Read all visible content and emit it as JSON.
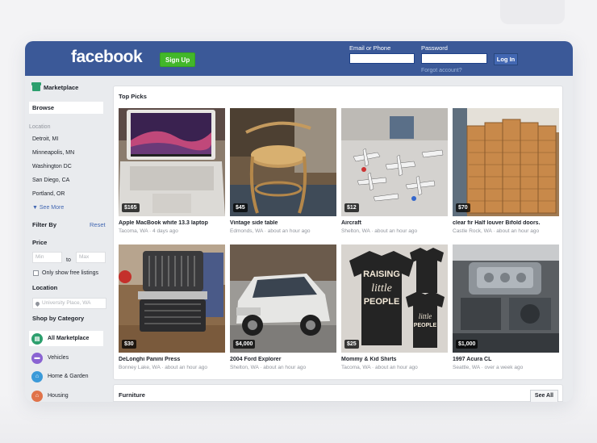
{
  "header": {
    "logo": "facebook",
    "signup_label": "Sign Up",
    "email_label": "Email or Phone",
    "password_label": "Password",
    "login_label": "Log In",
    "forgot_label": "Forgot account?"
  },
  "sidebar": {
    "title": "Marketplace",
    "browse": "Browse",
    "location_label": "Location",
    "locations": [
      "Detroit, MI",
      "Minneapolis, MN",
      "Washington DC",
      "San Diego, CA",
      "Portland, OR"
    ],
    "see_more": "See More",
    "filter_by": "Filter By",
    "reset": "Reset",
    "price_label": "Price",
    "min_placeholder": "Min",
    "to_label": "to",
    "max_placeholder": "Max",
    "free_listings": "Only show free listings",
    "location_head": "Location",
    "location_placeholder": "University Place, WA",
    "shop_by_category": "Shop by Category",
    "categories": [
      {
        "label": "All Marketplace",
        "icon": "storefront-icon",
        "color": "#2d9f6e"
      },
      {
        "label": "Vehicles",
        "icon": "car-icon",
        "color": "#8a63d2"
      },
      {
        "label": "Home & Garden",
        "icon": "house-icon",
        "color": "#3b9ad9"
      },
      {
        "label": "Housing",
        "icon": "key-icon",
        "color": "#e0734a"
      }
    ]
  },
  "main": {
    "title": "Top Picks",
    "items": [
      {
        "price": "$165",
        "title": "Apple MacBook white 13.3 laptop",
        "sub": "Tacoma, WA · 4 days ago"
      },
      {
        "price": "$45",
        "title": "Vintage side table",
        "sub": "Edmonds, WA · about an hour ago"
      },
      {
        "price": "$12",
        "title": "Aircraft",
        "sub": "Shelton, WA · about an hour ago"
      },
      {
        "price": "$70",
        "title": "clear fir Half louver Bifold doors.",
        "sub": "Castle Rock, WA · about an hour ago"
      },
      {
        "price": "$30",
        "title": "DeLonghi Panini Press",
        "sub": "Bonney Lake, WA · about an hour ago"
      },
      {
        "price": "$4,000",
        "title": "2004 Ford Explorer",
        "sub": "Shelton, WA · about an hour ago"
      },
      {
        "price": "$25",
        "title": "Mommy & Kid Shirts",
        "sub": "Tacoma, WA · about an hour ago"
      },
      {
        "price": "$1,000",
        "title": "1997 Acura CL",
        "sub": "Seattle, WA · over a week ago"
      }
    ]
  },
  "furniture": {
    "title": "Furniture",
    "see_all": "See All"
  },
  "shirt_text": {
    "big_line1": "RAISING",
    "big_line2": "little",
    "big_line3": "PEOPLE",
    "small_line1": "little",
    "small_line2": "PEOPLE"
  },
  "colors": {
    "brand": "#3b5998",
    "signup": "#42b72a",
    "link": "#4267b2"
  }
}
